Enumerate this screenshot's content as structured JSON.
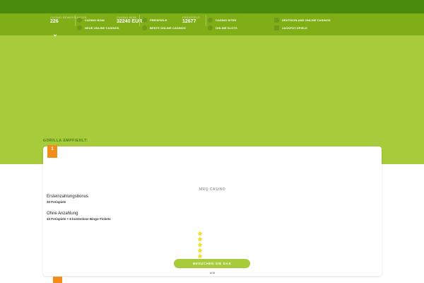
{
  "colors": {
    "top_strip": "#4a8a0a",
    "stats_bar": "#7fae17",
    "hero_green": "#a8cb3c",
    "accent_orange": "#f28d1c",
    "star_yellow": "#f6dd16"
  },
  "stats": [
    {
      "label": "Casino Bewertungen",
      "value": "226"
    },
    {
      "label": "Casino Boni",
      "value": "32240 EURO"
    },
    {
      "label": "Freispiele",
      "value": "12677"
    }
  ],
  "nav": [
    {
      "label": "Casino Boni",
      "icon": "casino-chip-icon"
    },
    {
      "label": "Freispiele",
      "icon": "gift-icon"
    },
    {
      "label": "Casino Sites",
      "icon": "globe-icon"
    },
    {
      "label": "Deutschland Online Casinos",
      "icon": "germany-flag-icon"
    },
    {
      "label": "Neue Online Casinos",
      "icon": "new-badge-icon"
    },
    {
      "label": "Beste Online Casinos",
      "icon": "trophy-icon"
    },
    {
      "label": "Online Slots",
      "icon": "slot-machine-icon"
    },
    {
      "label": "Jackpot-Spiele",
      "icon": "jackpot-icon"
    }
  ],
  "recommend_heading": "GORILLA EMPFIEHLT:",
  "casino_card": {
    "rank": "1",
    "name": "MRQ CASINO",
    "bonuses": [
      {
        "title": "Ersteinzahlungsbonus",
        "detail": "30 Freispiele"
      },
      {
        "title": "Ohne Anzahlung",
        "detail": "10 Freispiele + 6 kostenlose Bingo-Tickets"
      }
    ],
    "rating_stars": 5,
    "visit_button": "BESUCHEN SIE DAS",
    "note": "AGB"
  }
}
